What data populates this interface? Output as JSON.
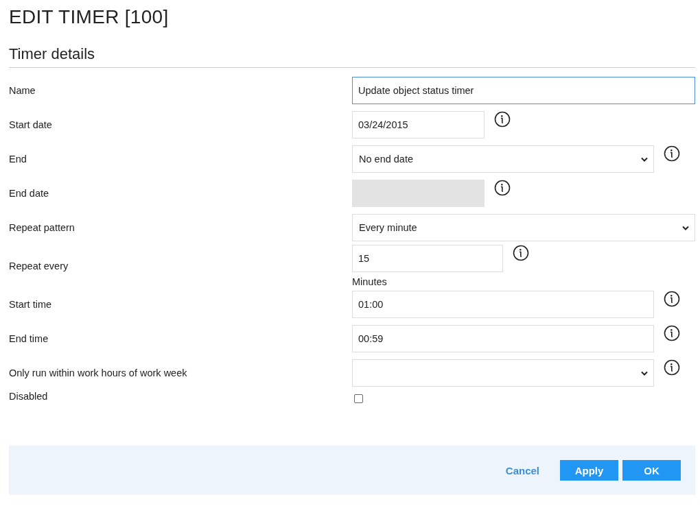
{
  "title": "EDIT TIMER [100]",
  "section": {
    "title": "Timer details"
  },
  "fields": [
    {
      "label": "Name",
      "kind": "text",
      "value": "Update object status timer",
      "focused": true,
      "info": false
    },
    {
      "label": "Start date",
      "kind": "date",
      "value": "03/24/2015",
      "focused": false,
      "info": true
    },
    {
      "label": "End",
      "kind": "select",
      "value": "No end date",
      "info": true
    },
    {
      "label": "End date",
      "kind": "date",
      "disabled": true,
      "focused": false,
      "info": true
    },
    {
      "label": "Repeat pattern",
      "kind": "select",
      "value": "Every minute",
      "info": false
    },
    {
      "label": "Repeat every",
      "kind": "number",
      "value": "15",
      "unit": "Minutes",
      "focused": false,
      "info": true
    },
    {
      "label": "Start time",
      "kind": "text",
      "value": "01:00",
      "focused": false,
      "info": true
    },
    {
      "label": "End time",
      "kind": "text",
      "value": "00:59",
      "focused": false,
      "info": true
    },
    {
      "label": "Only run within work hours of work week",
      "kind": "select",
      "info": true
    },
    {
      "label": "Disabled",
      "kind": "checkbox",
      "checked": false,
      "info": false
    }
  ],
  "buttons": [
    {
      "label": "Cancel",
      "kind": "link"
    },
    {
      "label": "Apply",
      "kind": "primary"
    },
    {
      "label": "OK",
      "kind": "primary"
    }
  ]
}
